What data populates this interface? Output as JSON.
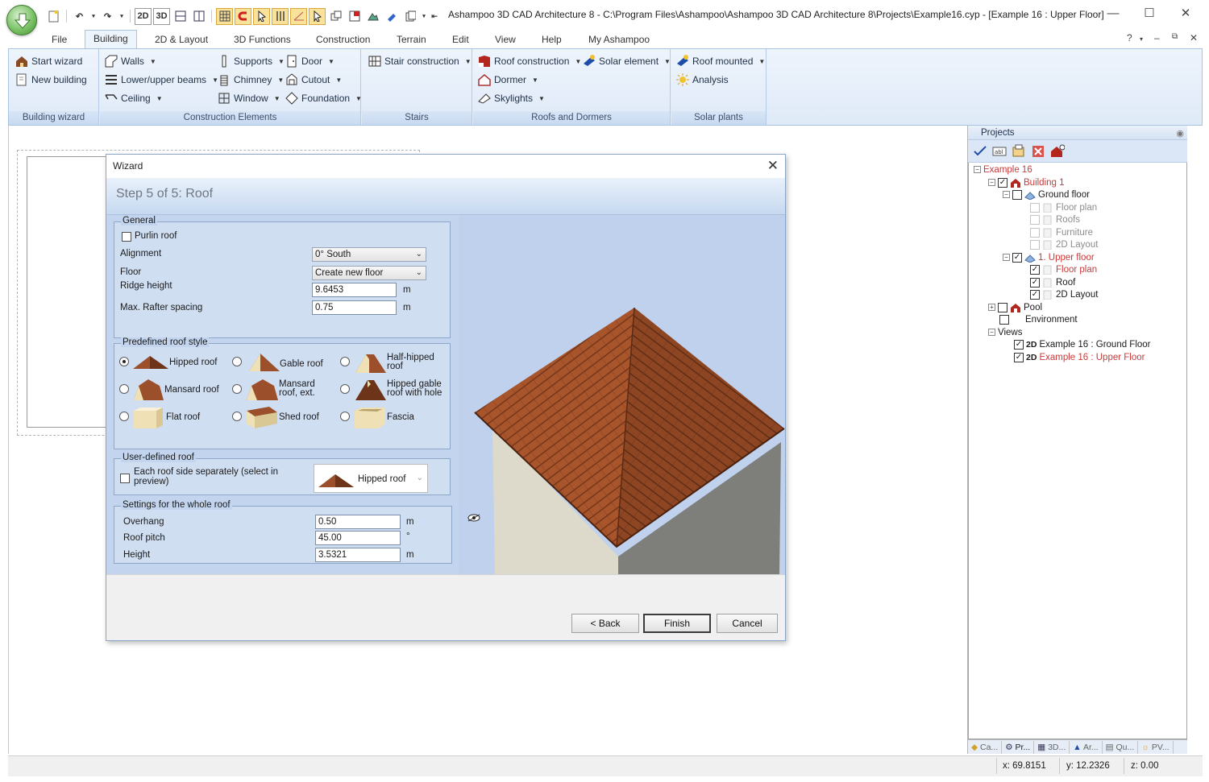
{
  "window": {
    "title": "Ashampoo 3D CAD Architecture 8 - C:\\Program Files\\Ashampoo\\Ashampoo 3D CAD Architecture 8\\Projects\\Example16.cyp - [Example 16 : Upper Floor]",
    "minimize": "—",
    "maximize": "☐",
    "close": "✕"
  },
  "quick_access": {
    "btn_2d": "2D",
    "btn_3d": "3D"
  },
  "ribbon": {
    "tabs": [
      "File",
      "Building",
      "2D & Layout",
      "3D Functions",
      "Construction",
      "Terrain",
      "Edit",
      "View",
      "Help",
      "My Ashampoo"
    ],
    "active_tab": "Building",
    "groups": {
      "wizard": {
        "label": "Building wizard",
        "start": "Start wizard",
        "new": "New building"
      },
      "construction": {
        "label": "Construction Elements",
        "walls": "Walls",
        "beams": "Lower/upper beams",
        "ceiling": "Ceiling",
        "supports": "Supports",
        "chimney": "Chimney",
        "window": "Window",
        "door": "Door",
        "cutout": "Cutout",
        "foundation": "Foundation"
      },
      "stairs": {
        "label": "Stairs",
        "stair": "Stair construction"
      },
      "roofs": {
        "label": "Roofs and Dormers",
        "roof_construction": "Roof construction",
        "dormer": "Dormer",
        "skylights": "Skylights",
        "solar_element": "Solar element"
      },
      "solar": {
        "label": "Solar plants",
        "roof_mounted": "Roof mounted",
        "analysis": "Analysis"
      }
    }
  },
  "wizard": {
    "title": "Wizard",
    "step": "Step 5 of 5:  Roof",
    "general": {
      "legend": "General",
      "purlin_label": "Purlin roof",
      "purlin_checked": false,
      "alignment_label": "Alignment",
      "alignment_value": "0° South",
      "floor_label": "Floor",
      "floor_value": "Create new floor",
      "ridge_label": "Ridge height",
      "ridge_value": "9.6453",
      "ridge_unit": "m",
      "rafter_label": "Max. Rafter spacing",
      "rafter_value": "0.75",
      "rafter_unit": "m"
    },
    "predefined": {
      "legend": "Predefined roof style",
      "options": {
        "hipped": "Hipped roof",
        "gable": "Gable roof",
        "half_hipped_1": "Half-hipped",
        "half_hipped_2": "roof",
        "mansard": "Mansard roof",
        "mansard_ext_1": "Mansard",
        "mansard_ext_2": "roof, ext.",
        "hipped_gable_1": "Hipped gable",
        "hipped_gable_2": "roof with hole",
        "flat": "Flat roof",
        "shed": "Shed roof",
        "fascia": "Fascia"
      },
      "selected": "Hipped roof"
    },
    "user_defined": {
      "legend": "User-defined roof",
      "each_side_1": "Each roof side separately (select in",
      "each_side_2": "preview)",
      "each_side_checked": false,
      "roof_type": "Hipped roof"
    },
    "whole_roof": {
      "legend": "Settings for the whole roof",
      "overhang_label": "Overhang",
      "overhang_value": "0.50",
      "overhang_unit": "m",
      "pitch_label": "Roof pitch",
      "pitch_value": "45.00",
      "pitch_unit": "°",
      "height_label": "Height",
      "height_value": "3.5321",
      "height_unit": "m"
    },
    "buttons": {
      "back": "< Back",
      "finish": "Finish",
      "cancel": "Cancel"
    }
  },
  "projects": {
    "title": "Projects",
    "tree": {
      "example": "Example 16",
      "building": "Building 1",
      "ground_floor": "Ground floor",
      "gf_floor_plan": "Floor plan",
      "gf_roofs": "Roofs",
      "gf_furniture": "Furniture",
      "gf_2d_layout": "2D Layout",
      "upper_floor": "1. Upper floor",
      "uf_floor_plan": "Floor plan",
      "uf_roof": "Roof",
      "uf_2d_layout": "2D Layout",
      "pool": "Pool",
      "environment": "Environment",
      "views": "Views",
      "view1": "Example 16 : Ground Floor",
      "view2": "Example 16 : Upper Floor",
      "view_badge": "2D"
    },
    "bottom_tabs": [
      "Ca...",
      "Pr...",
      "3D...",
      "Ar...",
      "Qu...",
      "PV..."
    ]
  },
  "status": {
    "x": "x: 69.8151",
    "y": "y: 12.2326",
    "z": "z: 0.00"
  },
  "colors": {
    "accent": "#c3d5ee",
    "roof": "#9b4f2a",
    "highlight_text": "#c73a3a"
  }
}
